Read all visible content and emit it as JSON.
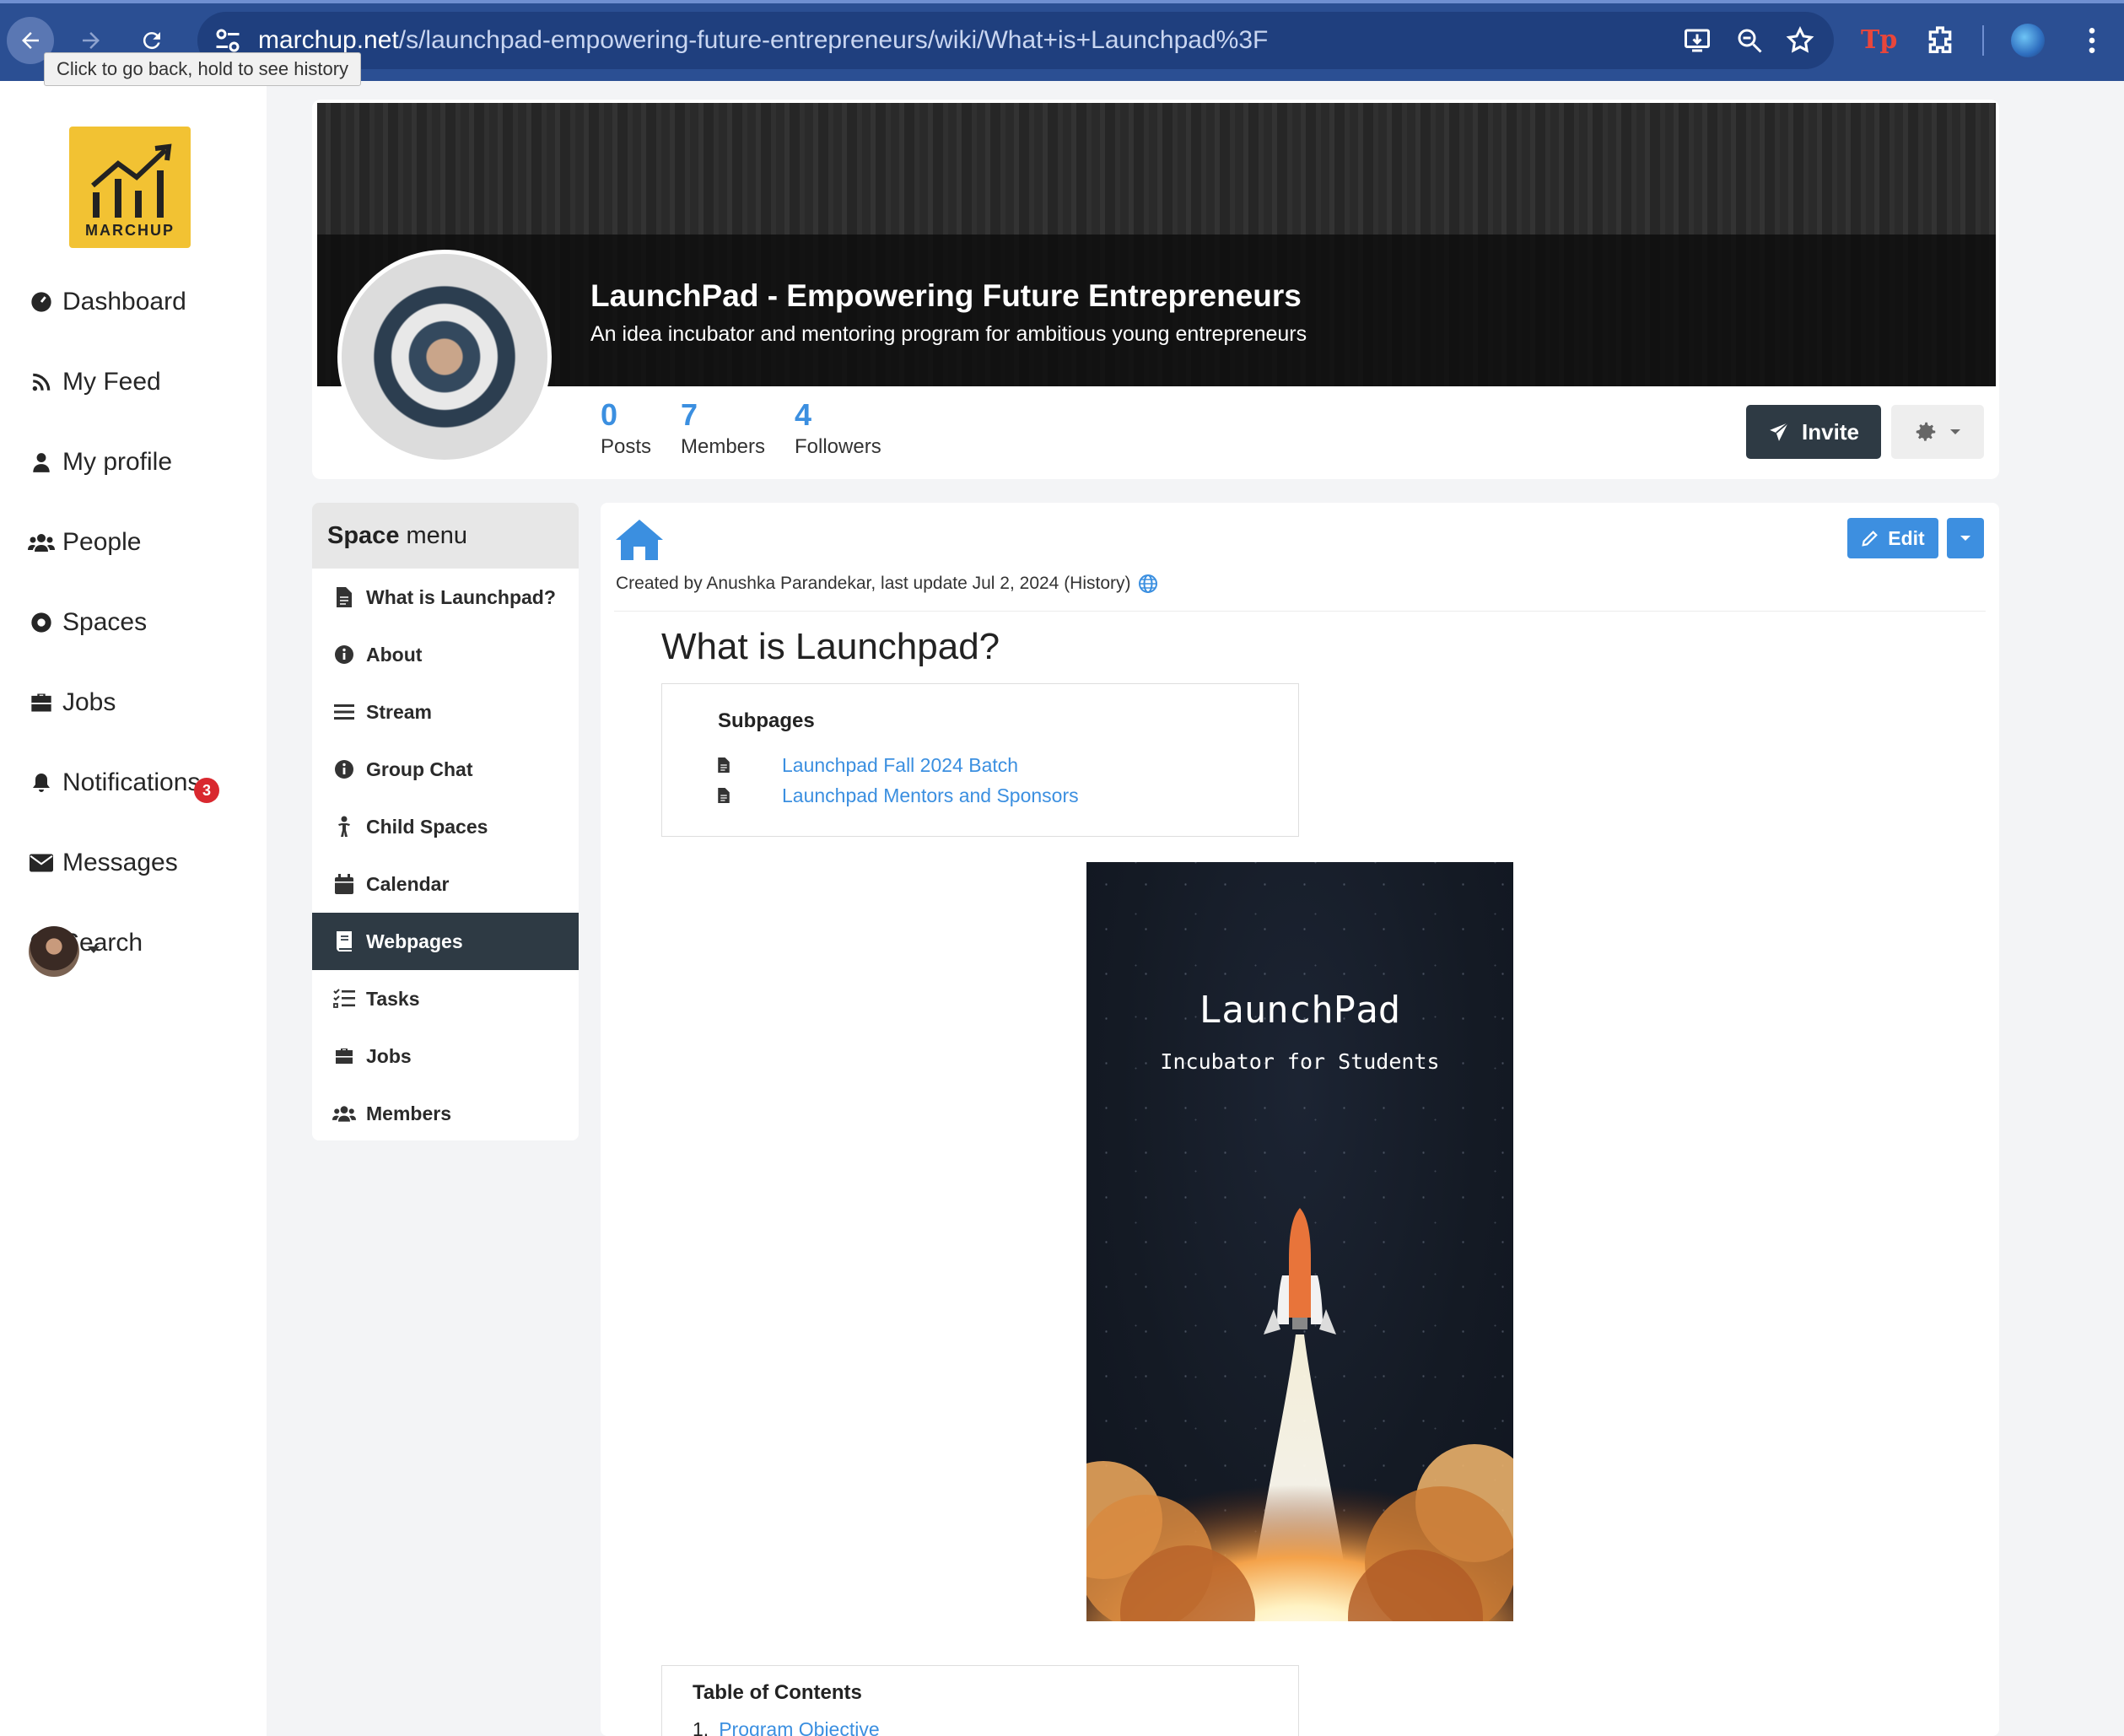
{
  "browser": {
    "url_host": "marchup.net",
    "url_path": "/s/launchpad-empowering-future-entrepreneurs/wiki/What+is+Launchpad%3F",
    "tooltip": "Click to go back, hold to see history",
    "ext_label": "Tp"
  },
  "leftnav": {
    "logo_text": "MARCHUP",
    "items": [
      {
        "label": "Dashboard",
        "icon": "dashboard-icon"
      },
      {
        "label": "My Feed",
        "icon": "rss-icon"
      },
      {
        "label": "My profile",
        "icon": "user-icon"
      },
      {
        "label": "People",
        "icon": "users-icon"
      },
      {
        "label": "Spaces",
        "icon": "circle-dot-icon"
      },
      {
        "label": "Jobs",
        "icon": "briefcase-icon"
      },
      {
        "label": "Notifications",
        "icon": "bell-icon"
      },
      {
        "label": "Messages",
        "icon": "envelope-icon"
      },
      {
        "label": "Search",
        "icon": "search-icon"
      }
    ],
    "notifications_count": "3"
  },
  "space": {
    "title": "LaunchPad - Empowering Future Entrepreneurs",
    "subtitle": "An idea incubator and mentoring program for ambitious young entrepreneurs",
    "stats": [
      {
        "value": "0",
        "label": "Posts"
      },
      {
        "value": "7",
        "label": "Members"
      },
      {
        "value": "4",
        "label": "Followers"
      }
    ],
    "invite_label": "Invite"
  },
  "space_menu": {
    "header_bold": "Space",
    "header_rest": " menu",
    "items": [
      {
        "label": "What is Launchpad?",
        "icon": "file-icon",
        "active": false
      },
      {
        "label": "About",
        "icon": "info-icon",
        "active": false
      },
      {
        "label": "Stream",
        "icon": "bars-icon",
        "active": false
      },
      {
        "label": "Group Chat",
        "icon": "info-icon",
        "active": false
      },
      {
        "label": "Child Spaces",
        "icon": "child-icon",
        "active": false
      },
      {
        "label": "Calendar",
        "icon": "calendar-icon",
        "active": false
      },
      {
        "label": "Webpages",
        "icon": "book-icon",
        "active": true
      },
      {
        "label": "Tasks",
        "icon": "tasks-icon",
        "active": false
      },
      {
        "label": "Jobs",
        "icon": "briefcase-icon",
        "active": false
      },
      {
        "label": "Members",
        "icon": "users-icon",
        "active": false
      }
    ]
  },
  "page": {
    "edit_label": "Edit",
    "created_text": "Created by Anushka Parandekar, last update Jul 2, 2024 (History)",
    "title": "What is Launchpad?",
    "subpages_title": "Subpages",
    "subpages": [
      "Launchpad Fall 2024 Batch",
      "Launchpad Mentors and Sponsors"
    ],
    "poster_title": "LaunchPad",
    "poster_subtitle": "Incubator for Students",
    "toc_title": "Table of Contents",
    "toc_first_num": "1.",
    "toc_first_item": "Program Objective"
  },
  "colors": {
    "accent": "#3b8fe0",
    "dark": "#2e3a44",
    "browser": "#2b4f93",
    "badge": "#d9282f",
    "logo": "#f2c233"
  }
}
